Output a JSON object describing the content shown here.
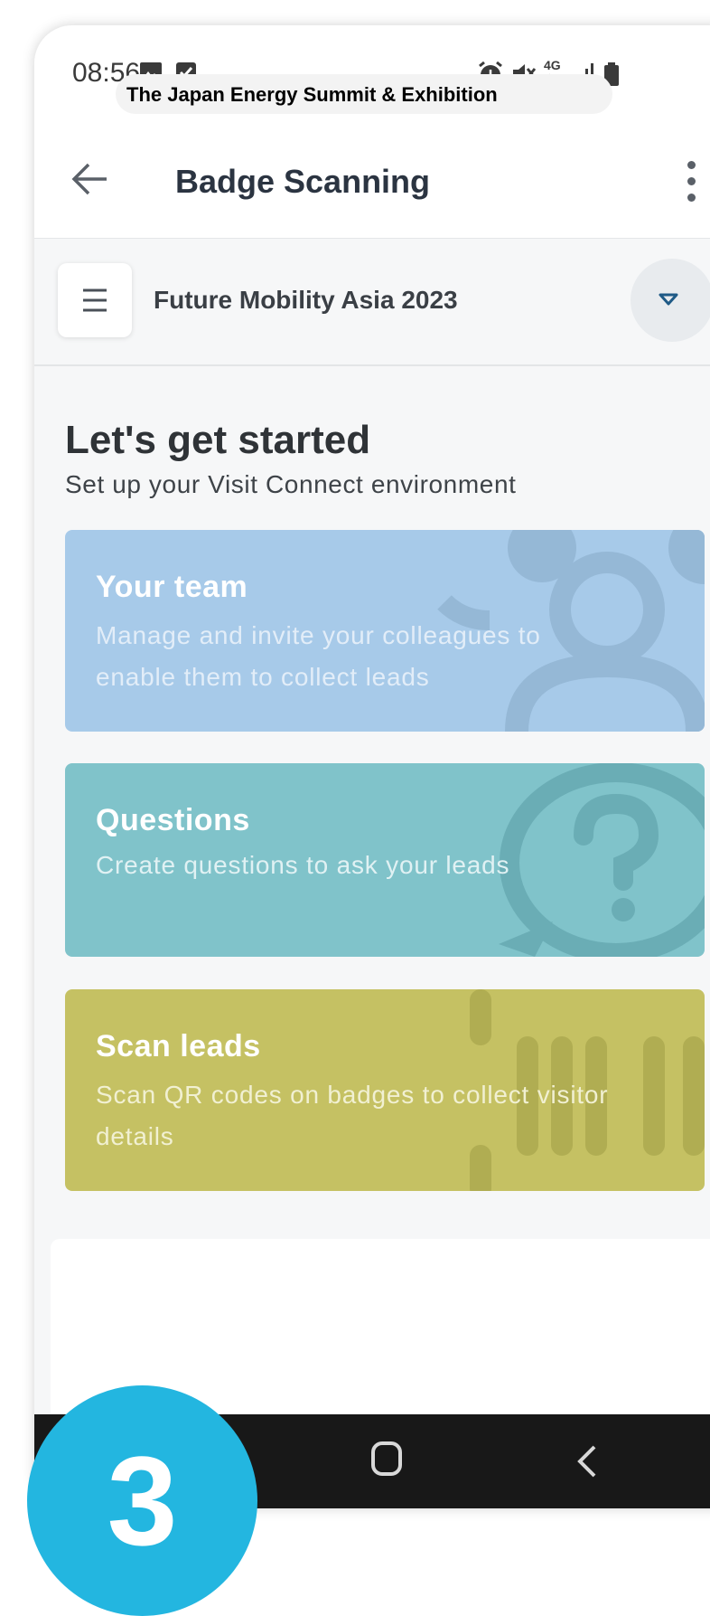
{
  "status_bar": {
    "time": "08:56",
    "left_icons": [
      "image-icon",
      "check-square-icon"
    ],
    "right_icons": [
      "alarm-icon",
      "mute-icon",
      "4g-icon",
      "signal-icon",
      "battery-icon"
    ],
    "network_label": "4G"
  },
  "app_bar": {
    "title": "Badge Scanning",
    "subtitle": "The Japan Energy Summit & Exhibition"
  },
  "event_selector": {
    "event_name": "Future Mobility Asia 2023"
  },
  "intro": {
    "heading": "Let's get started",
    "subheading": "Set up your Visit Connect environment"
  },
  "cards": [
    {
      "title": "Your team",
      "description_line1": "Manage and invite your colleagues to",
      "description_line2": "enable them to collect leads",
      "color": "#a7cae9"
    },
    {
      "title": "Questions",
      "description_line1": "Create questions to ask your leads",
      "color": "#80c3ca"
    },
    {
      "title": "Scan leads",
      "description_line1": "Scan QR codes on badges to collect visitor",
      "description_line2": "details",
      "color": "#c5c163"
    }
  ],
  "step_badge": {
    "number": "3",
    "color": "#23b6e0"
  }
}
